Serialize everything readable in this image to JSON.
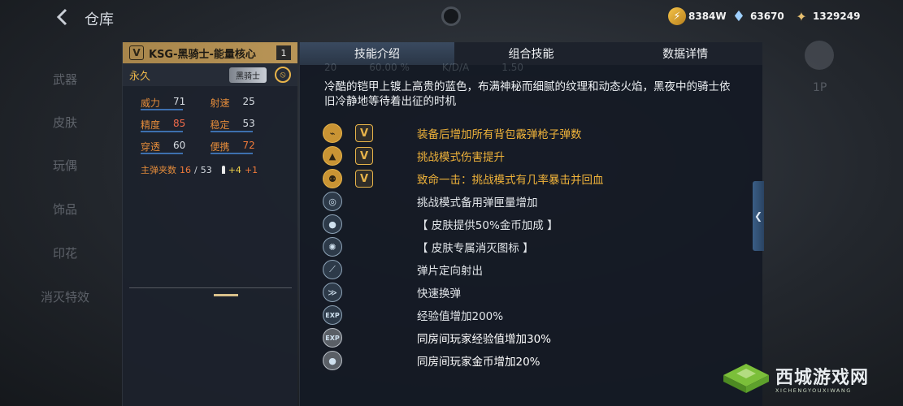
{
  "header": {
    "back_icon": "back-chevron-icon",
    "title": "仓库",
    "currencies": [
      {
        "icon": "gold-coin-icon",
        "value": "8384W"
      },
      {
        "icon": "diamond-icon",
        "value": "63670"
      },
      {
        "icon": "crystal-icon",
        "value": "1329249"
      }
    ]
  },
  "left_nav": {
    "items": [
      "武器",
      "皮肤",
      "玩偶",
      "饰品",
      "印花",
      "消灭特效"
    ]
  },
  "weapon": {
    "badge": "V",
    "name": "KSG-黑骑士-能量核心",
    "count": "1",
    "duration": "永久",
    "tag": "黑骑士",
    "stats": [
      {
        "label": "威力",
        "value": "71"
      },
      {
        "label": "射速",
        "value": "25"
      },
      {
        "label": "精度",
        "value": "85"
      },
      {
        "label": "稳定",
        "value": "53"
      },
      {
        "label": "穿透",
        "value": "60"
      },
      {
        "label": "便携",
        "value": "72"
      }
    ],
    "magazine": {
      "label": "主弹夹数",
      "current": "16",
      "separator": "/",
      "total": "53",
      "bonus_a": "+4",
      "bonus_b": "+1"
    }
  },
  "detail": {
    "tabs": [
      {
        "label": "技能介绍",
        "active": true
      },
      {
        "label": "组合技能",
        "active": false
      },
      {
        "label": "数据详情",
        "active": false
      }
    ],
    "ghost_values": [
      "20",
      "60.00 %",
      "K/D/A",
      "1.50"
    ],
    "description": "冷酷的铠甲上镀上高贵的蓝色，布满神秘而细腻的纹理和动态火焰，黑夜中的骑士依旧冷静地等待着出征的时机",
    "skills": [
      {
        "icon": "ammo-bag-icon",
        "style": "gold",
        "has_v": true,
        "text": "装备后增加所有背包霰弹枪子弹数"
      },
      {
        "icon": "challenge-damage-icon",
        "style": "gold",
        "has_v": true,
        "text": "挑战模式伤害提升"
      },
      {
        "icon": "crit-heal-icon",
        "style": "gold",
        "has_v": true,
        "text": "致命一击：挑战模式有几率暴击并回血"
      },
      {
        "icon": "spare-ammo-icon",
        "style": "normal",
        "has_v": false,
        "text": "挑战模式备用弹匣量增加"
      },
      {
        "icon": "gold-bonus-icon",
        "style": "normal",
        "has_v": false,
        "text": "【 皮肤提供50%金币加成 】"
      },
      {
        "icon": "kill-icon-badge",
        "style": "normal",
        "has_v": false,
        "text": "【 皮肤专属消灭图标 】"
      },
      {
        "icon": "fixed-spread-icon",
        "style": "normal",
        "has_v": false,
        "text": "弹片定向射出"
      },
      {
        "icon": "fast-reload-icon",
        "style": "normal",
        "has_v": false,
        "text": "快速换弹"
      },
      {
        "icon": "exp-icon",
        "style": "normal",
        "has_v": false,
        "text": "经验值增加200%"
      },
      {
        "icon": "room-exp-icon",
        "style": "white",
        "has_v": false,
        "text": "同房间玩家经验值增加30%"
      },
      {
        "icon": "room-gold-icon",
        "style": "white",
        "has_v": false,
        "text": "同房间玩家金币增加20%"
      }
    ]
  },
  "right_side": {
    "collapse_icon": "collapse-left-icon",
    "ghost_text": "1P"
  },
  "watermark": {
    "title": "西城游戏网",
    "subtitle": "XICHENGYOUXIWANG"
  },
  "colors": {
    "accent_gold": "#e8b44a",
    "orange_stat": "#f07a3a",
    "blue_bar": "#3d6fae",
    "header_gold": "#b99557"
  }
}
